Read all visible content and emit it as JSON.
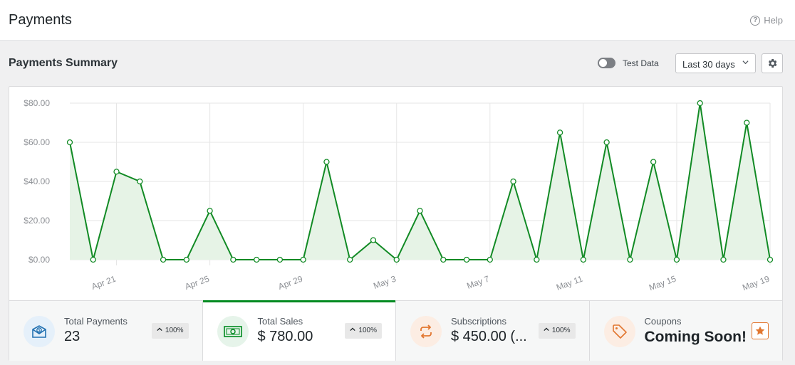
{
  "page": {
    "title": "Payments",
    "help_label": "Help"
  },
  "summary": {
    "title": "Payments Summary"
  },
  "controls": {
    "test_data_label": "Test Data",
    "test_data_on": false,
    "range_value": "Last 30 days"
  },
  "colors": {
    "line": "#118a24",
    "fill": "#e6f3e6",
    "accent_green": "#008a20",
    "accent_orange": "#e27730",
    "accent_blue": "#2271b1"
  },
  "stats": [
    {
      "label": "Total Payments",
      "value": "23",
      "change": "100%",
      "icon": "money-envelope-icon"
    },
    {
      "label": "Total Sales",
      "value": "$ 780.00",
      "change": "100%",
      "icon": "cash-bill-icon"
    },
    {
      "label": "Subscriptions",
      "value": "$ 450.00 (...",
      "change": "100%",
      "icon": "repeat-icon"
    },
    {
      "label": "Coupons",
      "value": "Coming Soon!",
      "icon": "tag-icon",
      "action_icon": "star-icon"
    }
  ],
  "chart_data": {
    "type": "area",
    "title": "",
    "xlabel": "",
    "ylabel": "",
    "ylim": [
      0,
      80
    ],
    "y_ticks": [
      "$0.00",
      "$20.00",
      "$40.00",
      "$60.00",
      "$80.00"
    ],
    "y_tick_values": [
      0,
      20,
      40,
      60,
      80
    ],
    "x_tick_labels": [
      "Apr 21",
      "Apr 25",
      "Apr 29",
      "May 3",
      "May 7",
      "May 11",
      "May 15",
      "May 19"
    ],
    "x_tick_indices": [
      2,
      6,
      10,
      14,
      18,
      22,
      26,
      30
    ],
    "x": [
      "Apr 19",
      "Apr 20",
      "Apr 21",
      "Apr 22",
      "Apr 23",
      "Apr 24",
      "Apr 25",
      "Apr 26",
      "Apr 27",
      "Apr 28",
      "Apr 29",
      "Apr 30",
      "May 1",
      "May 2",
      "May 3",
      "May 4",
      "May 5",
      "May 6",
      "May 7",
      "May 8",
      "May 9",
      "May 10",
      "May 11",
      "May 12",
      "May 13",
      "May 14",
      "May 15",
      "May 16",
      "May 17",
      "May 18",
      "May 19"
    ],
    "values": [
      60,
      0,
      45,
      40,
      0,
      0,
      25,
      0,
      0,
      0,
      0,
      50,
      0,
      10,
      0,
      25,
      0,
      0,
      0,
      40,
      0,
      65,
      0,
      60,
      0,
      50,
      0,
      80,
      0,
      70,
      0
    ],
    "grid": true,
    "legend": "none"
  }
}
